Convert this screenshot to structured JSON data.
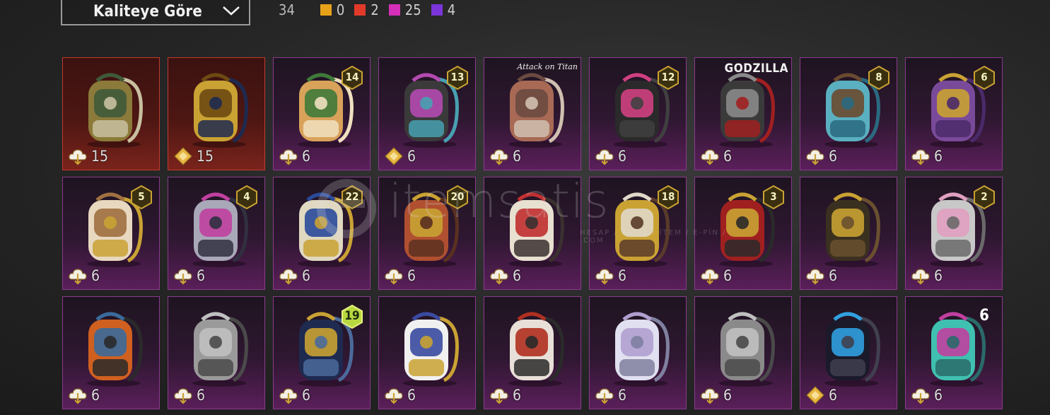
{
  "sort": {
    "label": "Kaliteye Göre",
    "icon": "chevron-down-icon"
  },
  "summary": {
    "total": "34",
    "counts": [
      {
        "color": "#e8a21a",
        "value": "0"
      },
      {
        "color": "#e23a2a",
        "value": "2"
      },
      {
        "color": "#d42fb8",
        "value": "25"
      },
      {
        "color": "#7b35d8",
        "value": "4"
      }
    ]
  },
  "watermark": {
    "text": "itemsatis",
    "sub": "HESAP / SATIŞ / İTEM / E-PİN / .COM"
  },
  "items": [
    {
      "tier": "legend",
      "art": "green-gold-backpack",
      "currency": "cloud",
      "price": "15"
    },
    {
      "tier": "legend",
      "art": "pharaoh-backpack",
      "currency": "diamond",
      "price": "15"
    },
    {
      "tier": "epic",
      "art": "corgi-backpack",
      "currency": "cloud",
      "price": "6",
      "level": "14"
    },
    {
      "tier": "epic",
      "art": "cyber-backpack",
      "currency": "diamond",
      "price": "6",
      "level": "13"
    },
    {
      "tier": "epic",
      "art": "titan-backpack",
      "currency": "cloud",
      "price": "6",
      "brand": "Attack on Titan"
    },
    {
      "tier": "epic",
      "art": "pink-bat-backpack",
      "currency": "cloud",
      "price": "6",
      "level": "12"
    },
    {
      "tier": "epic",
      "art": "godzilla-backpack",
      "currency": "cloud",
      "price": "6",
      "brand": "GODZILLA"
    },
    {
      "tier": "epic",
      "art": "octopus-backpack",
      "currency": "cloud",
      "price": "6",
      "level": "8"
    },
    {
      "tier": "epic",
      "art": "mirror-backpack",
      "currency": "cloud",
      "price": "6",
      "level": "6"
    },
    {
      "tier": "epic",
      "art": "ornate-white-backpack",
      "currency": "cloud",
      "price": "6",
      "level": "5"
    },
    {
      "tier": "epic",
      "art": "cat-pink-backpack",
      "currency": "cloud",
      "price": "6",
      "level": "4"
    },
    {
      "tier": "epic",
      "art": "blue-gold-backpack",
      "currency": "cloud",
      "price": "6",
      "level": "22"
    },
    {
      "tier": "epic",
      "art": "hamster-backpack",
      "currency": "cloud",
      "price": "6",
      "level": "20"
    },
    {
      "tier": "epic",
      "art": "lucky-cat-backpack",
      "currency": "cloud",
      "price": "6"
    },
    {
      "tier": "epic",
      "art": "skull-king-backpack",
      "currency": "cloud",
      "price": "6",
      "level": "18"
    },
    {
      "tier": "epic",
      "art": "clock-red-backpack",
      "currency": "cloud",
      "price": "6",
      "level": "3"
    },
    {
      "tier": "epic",
      "art": "dark-gold-backpack",
      "currency": "cloud",
      "price": "6"
    },
    {
      "tier": "epic",
      "art": "spiky-pink-backpack",
      "currency": "cloud",
      "price": "6",
      "level": "2"
    },
    {
      "tier": "epic",
      "art": "orange-hiker-backpack",
      "currency": "cloud",
      "price": "6"
    },
    {
      "tier": "epic",
      "art": "grey-tech-backpack",
      "currency": "cloud",
      "price": "6"
    },
    {
      "tier": "epic",
      "art": "beetle-backpack",
      "currency": "cloud",
      "price": "6",
      "level": "19",
      "levelStyle": "green"
    },
    {
      "tier": "epic",
      "art": "navy-white-backpack",
      "currency": "cloud",
      "price": "6"
    },
    {
      "tier": "epic",
      "art": "white-red-backpack",
      "currency": "cloud",
      "price": "6"
    },
    {
      "tier": "epic",
      "art": "unicorn-backpack",
      "currency": "cloud",
      "price": "6"
    },
    {
      "tier": "epic",
      "art": "elephant-backpack",
      "currency": "cloud",
      "price": "6"
    },
    {
      "tier": "epic",
      "art": "neon-blue-backpack",
      "currency": "diamond",
      "price": "6"
    },
    {
      "tier": "epic",
      "art": "teal-crown-backpack",
      "currency": "cloud",
      "price": "6",
      "level": "6",
      "levelStyle": "blue"
    }
  ]
}
